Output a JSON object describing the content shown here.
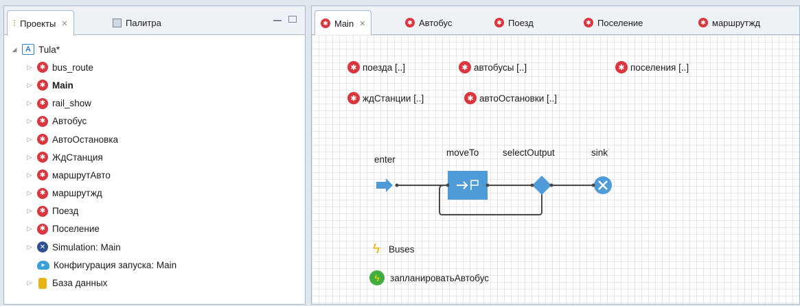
{
  "left": {
    "tabs": [
      {
        "label": "Проекты",
        "close": "✕"
      },
      {
        "label": "Палитра"
      }
    ],
    "tree": [
      {
        "label": "Tula*",
        "icon": "model-icon"
      },
      {
        "label": "bus_route",
        "icon": "agent-type-icon"
      },
      {
        "label": "Main",
        "icon": "agent-type-icon",
        "bold": true
      },
      {
        "label": "rail_show",
        "icon": "agent-type-icon"
      },
      {
        "label": "Автобус",
        "icon": "agent-type-icon"
      },
      {
        "label": "АвтоОстановка",
        "icon": "agent-type-icon"
      },
      {
        "label": "ЖдСтанция",
        "icon": "agent-type-icon"
      },
      {
        "label": "маршрутАвто",
        "icon": "agent-type-icon"
      },
      {
        "label": "маршрутжд",
        "icon": "agent-type-icon"
      },
      {
        "label": "Поезд",
        "icon": "agent-type-icon"
      },
      {
        "label": "Поселение",
        "icon": "agent-type-icon"
      },
      {
        "label": "Simulation: Main",
        "icon": "simulation-icon"
      },
      {
        "label": "Конфигурация запуска: Main",
        "icon": "cloud-icon"
      },
      {
        "label": "База данных",
        "icon": "database-icon"
      }
    ]
  },
  "right": {
    "tabs": [
      {
        "label": "Main",
        "close": "✕"
      },
      {
        "label": "Автобус"
      },
      {
        "label": "Поезд"
      },
      {
        "label": "Поселение"
      },
      {
        "label": "маршрутжд"
      }
    ],
    "agents": [
      "поезда [..]",
      "автобусы [..]",
      "поселения [..]",
      "ждСтанции [..]",
      "автоОстановки [..]"
    ],
    "blocks": {
      "enter": "enter",
      "moveTo": "moveTo",
      "selectOutput": "selectOutput",
      "sink": "sink"
    },
    "events": [
      {
        "label": "Buses",
        "icon": "event-icon"
      },
      {
        "label": "запланироватьАвтобус",
        "icon": "dynamic-event-icon"
      }
    ]
  },
  "colors": {
    "agent_red": "#d9363e",
    "block_blue": "#4f9bd8",
    "selection_blue": "#2f7fc8"
  }
}
